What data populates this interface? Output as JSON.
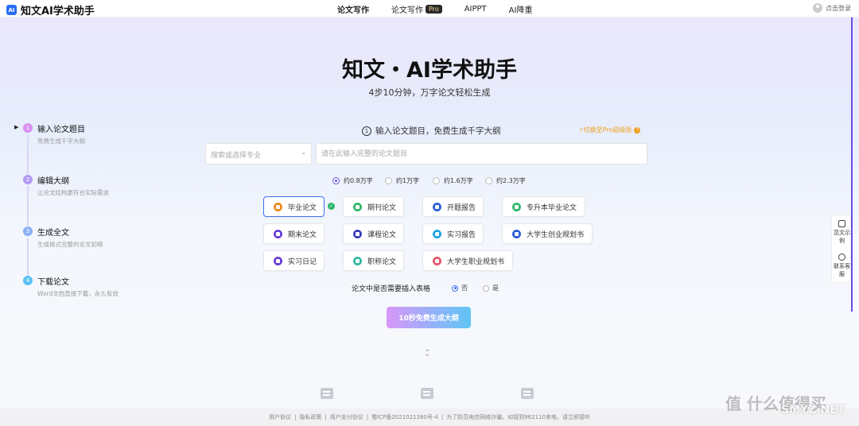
{
  "header": {
    "logo_mark": "AI",
    "logo_text": "知文AI学术助手",
    "nav": [
      {
        "label": "论文写作"
      },
      {
        "label": "论文写作",
        "badge": "Pro"
      },
      {
        "label": "AIPPT"
      },
      {
        "label": "AI降重"
      }
    ],
    "login_label": "点击登录"
  },
  "hero": {
    "title": "知文・AI学术助手",
    "subtitle": "4步10分钟，万字论文轻松生成"
  },
  "steps": [
    {
      "num": "1",
      "title": "输入论文题目",
      "desc": "免费生成千字大纲",
      "color": "#d990f0"
    },
    {
      "num": "2",
      "title": "编辑大纲",
      "desc": "让论文结构更符合实际需求",
      "color": "#b39af2"
    },
    {
      "num": "3",
      "title": "生成全文",
      "desc": "生成格式完整的论文初稿",
      "color": "#8ab0f4"
    },
    {
      "num": "4",
      "title": "下载论文",
      "desc": "Word文档直接下载，永久有效",
      "color": "#5cc2f2"
    }
  ],
  "form": {
    "step_num": "1",
    "heading": "输入论文题目，免费生成千字大纲",
    "switch_pro": "切换至Pro超级版",
    "switch_pro_help": "?",
    "major_placeholder": "搜索或选择专业",
    "title_placeholder": "请在此输入完整的论文题目",
    "lengths": [
      {
        "label": "约0.8万字",
        "selected": true
      },
      {
        "label": "约1万字",
        "selected": false
      },
      {
        "label": "约1.6万字",
        "selected": false
      },
      {
        "label": "约2.3万字",
        "selected": false
      }
    ],
    "types": [
      {
        "label": "毕业论文",
        "color": "#f08a1e",
        "selected": true
      },
      {
        "label": "期刊论文",
        "color": "#2fb86a"
      },
      {
        "label": "开题报告",
        "color": "#2b5fd9"
      },
      {
        "label": "专升本毕业论文",
        "color": "#2fb86a"
      },
      {
        "label": "期末论文",
        "color": "#6a3fd6"
      },
      {
        "label": "课程论文",
        "color": "#3b3fb8"
      },
      {
        "label": "实习报告",
        "color": "#1ea6e8"
      },
      {
        "label": "大学生创业规划书",
        "color": "#2b5fd9"
      },
      {
        "label": "实习日记",
        "color": "#6a3fd6"
      },
      {
        "label": "职称论文",
        "color": "#2fb8a0"
      },
      {
        "label": "大学生职业规划书",
        "color": "#e8556a"
      }
    ],
    "table_question": "论文中是否需要插入表格",
    "table_options": [
      {
        "label": "否",
        "selected": true
      },
      {
        "label": "是",
        "selected": false
      }
    ],
    "generate_label": "10秒免费生成大纲"
  },
  "side_panel": [
    {
      "label": "范文示例",
      "icon": "document-icon"
    },
    {
      "label": "联系客服",
      "icon": "chat-icon"
    }
  ],
  "footer": {
    "links": [
      "用户协议",
      "隐私政策",
      "用户支付协议",
      "蜀ICP备2021021380号-4",
      "为了防范电信网络诈骗，如接到962110来电，请立即接听"
    ]
  },
  "watermark": {
    "text": "值 什么值得买",
    "site": "SMYZ.NET"
  }
}
